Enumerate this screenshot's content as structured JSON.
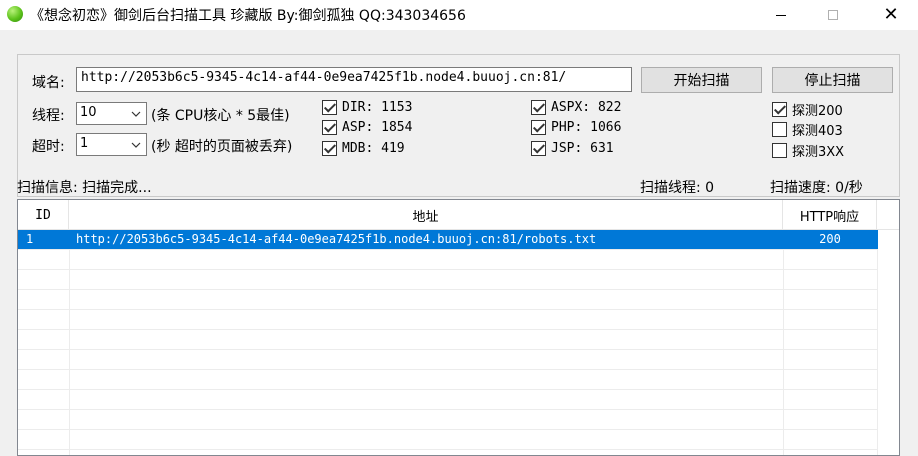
{
  "window": {
    "title": "《想念初恋》御剑后台扫描工具 珍藏版 By:御剑孤独 QQ:343034656",
    "icon": "green-ball-icon",
    "controls": {
      "minimize": "minimize-icon",
      "maximize": "maximize-icon",
      "close": "✕"
    }
  },
  "form": {
    "domain_label": "域名:",
    "domain_value": "http://2053b6c5-9345-4c14-af44-0e9ea7425f1b.node4.buuoj.cn:81/",
    "start_button": "开始扫描",
    "stop_button": "停止扫描",
    "threads_label": "线程:",
    "threads_value": "10",
    "threads_hint": "(条 CPU核心 * 5最佳)",
    "timeout_label": "超时:",
    "timeout_value": "1",
    "timeout_hint": "(秒 超时的页面被丢弃)"
  },
  "dictionaries": [
    {
      "label": "DIR: 1153",
      "checked": true
    },
    {
      "label": "ASP: 1854",
      "checked": true
    },
    {
      "label": "MDB: 419",
      "checked": true
    },
    {
      "label": "ASPX: 822",
      "checked": true
    },
    {
      "label": "PHP: 1066",
      "checked": true
    },
    {
      "label": "JSP: 631",
      "checked": true
    }
  ],
  "probes": [
    {
      "label": "探测200",
      "checked": true
    },
    {
      "label": "探测403",
      "checked": false
    },
    {
      "label": "探测3XX",
      "checked": false
    }
  ],
  "status": {
    "info": "扫描信息: 扫描完成...",
    "threads": "扫描线程: 0",
    "speed": "扫描速度: 0/秒"
  },
  "table": {
    "columns": [
      "ID",
      "地址",
      "HTTP响应"
    ],
    "rows": [
      {
        "id": "1",
        "url": "http://2053b6c5-9345-4c14-af44-0e9ea7425f1b.node4.buuoj.cn:81/robots.txt",
        "code": "200",
        "selected": true
      }
    ]
  },
  "colors": {
    "selection": "#0078d7",
    "window_bg": "#f0f0f0"
  }
}
